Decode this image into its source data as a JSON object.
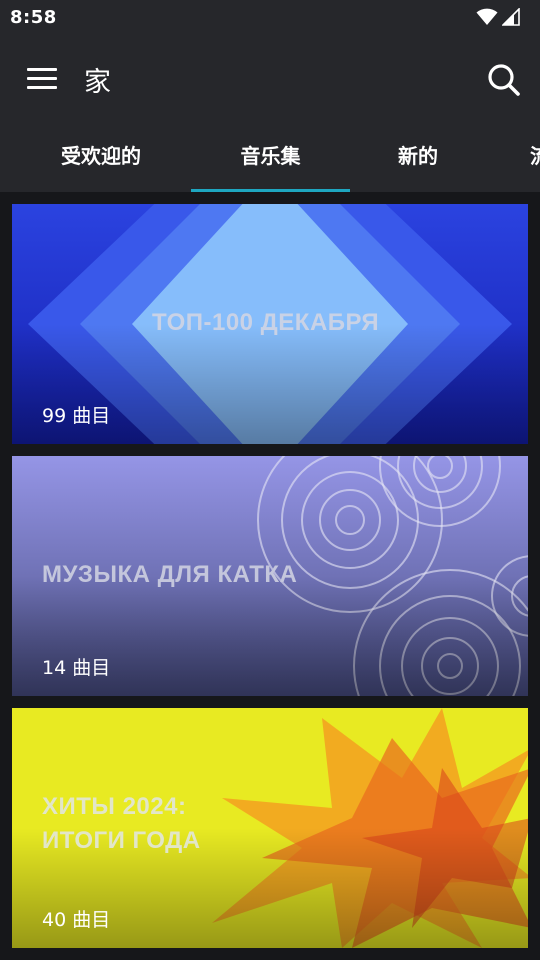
{
  "status_bar": {
    "time": "8:58"
  },
  "toolbar": {
    "title": "家"
  },
  "tabs": [
    {
      "label": "受欢迎的"
    },
    {
      "label": "音乐集"
    },
    {
      "label": "新的"
    },
    {
      "label": "流"
    }
  ],
  "active_tab": "音乐集",
  "collections": [
    {
      "title": "ТОП-100 ДЕКАБРЯ",
      "count": "99 曲目"
    },
    {
      "title": "МУЗЫКА ДЛЯ КАТКА",
      "count": "14 曲目"
    },
    {
      "title": "ХИТЫ 2024:\nИТОГИ ГОДА",
      "count": "40 曲目"
    }
  ],
  "colors": {
    "accent": "#1ea6c0",
    "bar": "#26272b",
    "background": "#16171a"
  },
  "icons": [
    "wifi-icon",
    "signal-icon",
    "menu-icon",
    "search-icon"
  ]
}
